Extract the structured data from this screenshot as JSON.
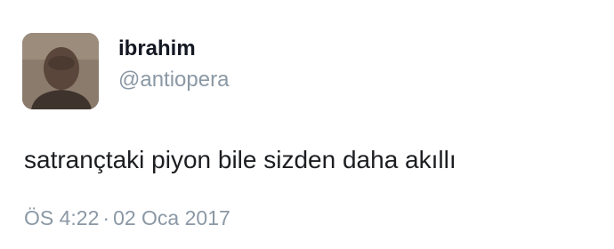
{
  "tweet": {
    "display_name": "ibrahim",
    "handle": "@antiopera",
    "text": "satrançtaki piyon bile sizden daha akıllı",
    "time": "ÖS 4:22",
    "separator": "·",
    "date": "02 Oca 2017"
  },
  "colors": {
    "name": "#141823",
    "secondary": "#8b98a5",
    "text": "#1c1e21",
    "background": "#ffffff"
  }
}
